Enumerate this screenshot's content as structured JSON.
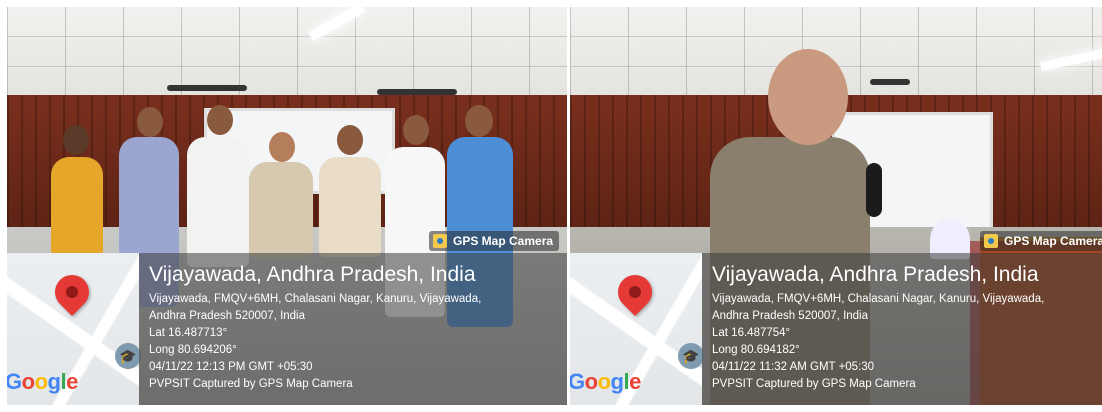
{
  "photos": [
    {
      "badge": "GPS Map Camera",
      "title": "Vijayawada, Andhra Pradesh, India",
      "address_line1": "Vijayawada, FMQV+6MH, Chalasani Nagar, Kanuru, Vijayawada,",
      "address_line2": "Andhra Pradesh 520007, India",
      "lat": "Lat 16.487713°",
      "long": "Long 80.694206°",
      "datetime": "04/11/22 12:13 PM GMT +05:30",
      "caption": "PVPSIT Captured by GPS Map Camera",
      "map_logo": "Google"
    },
    {
      "badge": "GPS Map Camera",
      "title": "Vijayawada, Andhra Pradesh, India",
      "address_line1": "Vijayawada, FMQV+6MH, Chalasani Nagar, Kanuru, Vijayawada,",
      "address_line2": "Andhra Pradesh 520007, India",
      "lat": "Lat 16.487754°",
      "long": "Long 80.694182°",
      "datetime": "04/11/22 11:32 AM GMT +05:30",
      "caption": "PVPSIT Captured by GPS Map Camera",
      "map_logo": "Google"
    }
  ],
  "icons": {
    "map_pin": "map-pin-icon",
    "graduation_cap": "graduation-cap-icon",
    "camera": "camera-icon"
  },
  "colors": {
    "pin": "#e53935",
    "overlay": "#3c3c3c",
    "wall": "#6a2818"
  }
}
